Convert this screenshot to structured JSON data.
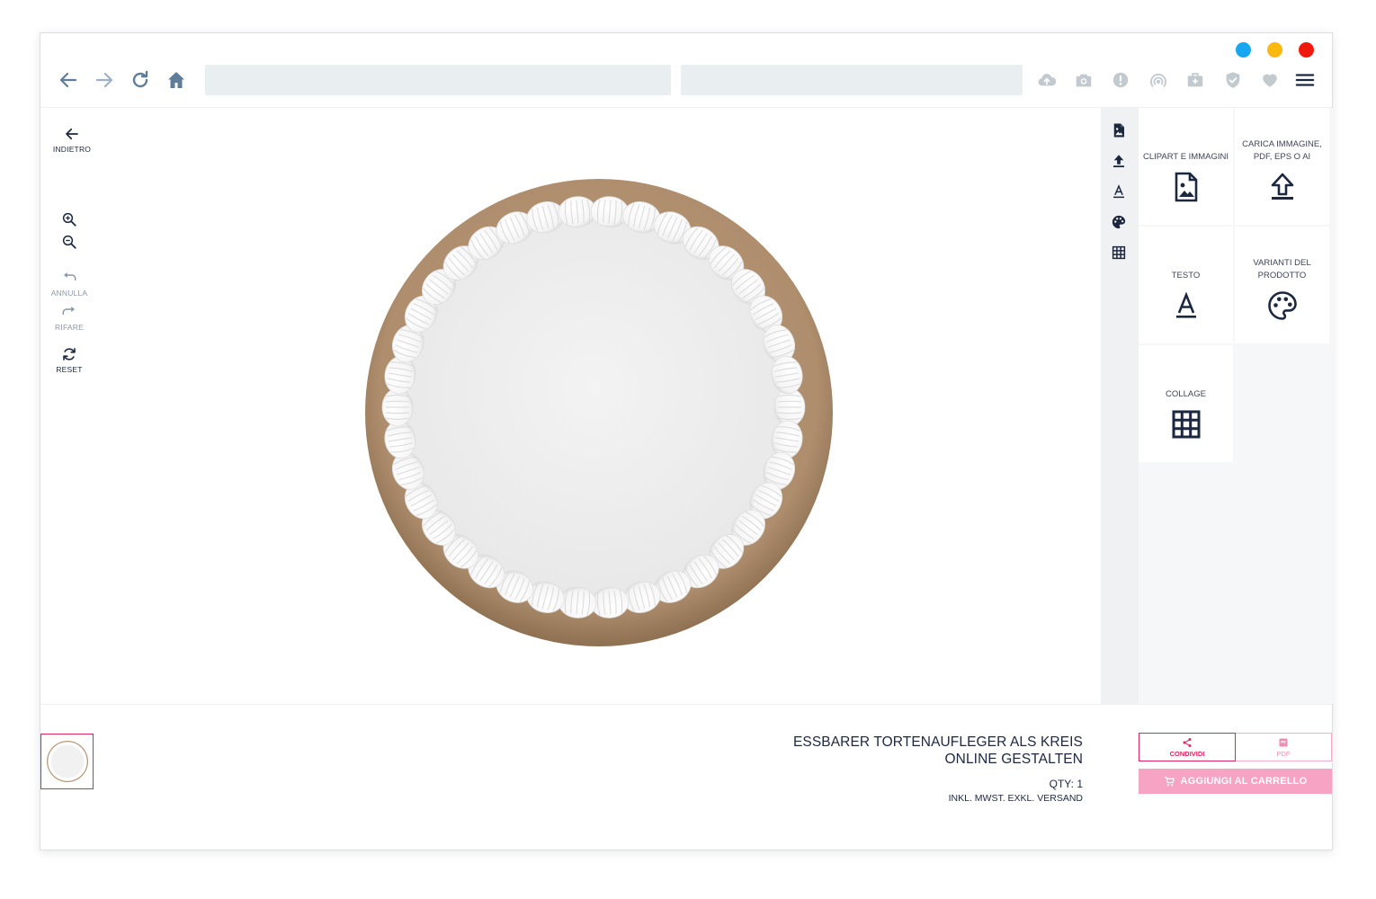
{
  "window": {
    "dots": [
      {
        "name": "blue-dot",
        "color": "#16a7f0"
      },
      {
        "name": "yellow-dot",
        "color": "#fbb80f"
      },
      {
        "name": "red-dot",
        "color": "#f01a0c"
      }
    ]
  },
  "browser": {
    "icons": [
      "back-arrow-icon",
      "forward-arrow-icon",
      "reload-icon",
      "home-icon",
      "lock-icon",
      "star-icon",
      "search-icon",
      "cloud-upload-icon",
      "camera-icon",
      "alert-icon",
      "broadcast-icon",
      "briefcase-icon",
      "shield-check-icon",
      "heart-icon",
      "hamburger-menu-icon"
    ],
    "url_value": "",
    "search_value": "",
    "icon_color": "#5f7d99",
    "ext_icon_color": "#c2c9cf"
  },
  "left_tools": {
    "back_label": "INDIETRO",
    "undo_label": "ANNULLA",
    "redo_label": "RIFARE",
    "reset_label": "RESET"
  },
  "tool_rail": [
    "image-file-icon",
    "upload-icon",
    "text-a-icon",
    "palette-icon",
    "grid-icon"
  ],
  "panel": {
    "tiles": [
      {
        "label": "CLIPART E IMMAGINI",
        "icon": "image-file-icon"
      },
      {
        "label": "CARICA IMMAGINE, PDF, EPS O AI",
        "icon": "upload-icon"
      },
      {
        "label": "TESTO",
        "icon": "text-a-icon"
      },
      {
        "label": "VARIANTI DEL PRODOTTO",
        "icon": "palette-icon"
      },
      {
        "label": "COLLAGE",
        "icon": "grid-icon"
      }
    ]
  },
  "product": {
    "title": "ESSBARER TORTENAUFLEGER ALS KREIS ONLINE GESTALTEN",
    "qty": "QTY: 1",
    "note": "INKL. MWST. EXKL. VERSAND"
  },
  "actions": {
    "share_label": "CONDIVIDI",
    "pdf_label": "PDF",
    "cart_label": "AGGIUNGI AL CARRELLO",
    "accent": "#e0245e",
    "cart_bg": "#f6a3c4"
  },
  "colors": {
    "dark": "#1c2740",
    "cake_base": "#b89877",
    "frosting": "#ffffff"
  }
}
